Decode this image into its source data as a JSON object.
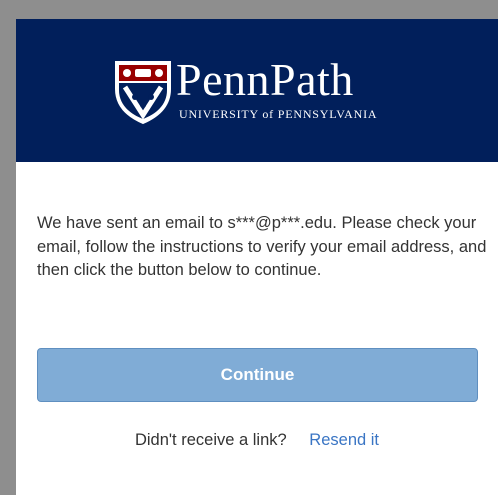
{
  "header": {
    "brand_name": "PennPath",
    "subtitle": "UNIVERSITY of PENNSYLVANIA",
    "background_color": "#011f5b"
  },
  "main": {
    "message": "We have sent an email to s***@p***.edu. Please check your email, follow the instructions to verify your email address, and then click the button below to continue.",
    "continue_label": "Continue",
    "resend_prompt": "Didn't receive a link?",
    "resend_link": "Resend it",
    "button_color": "#80acd6",
    "link_color": "#3a75c4"
  },
  "icons": {
    "logo": "penn-shield-icon"
  }
}
